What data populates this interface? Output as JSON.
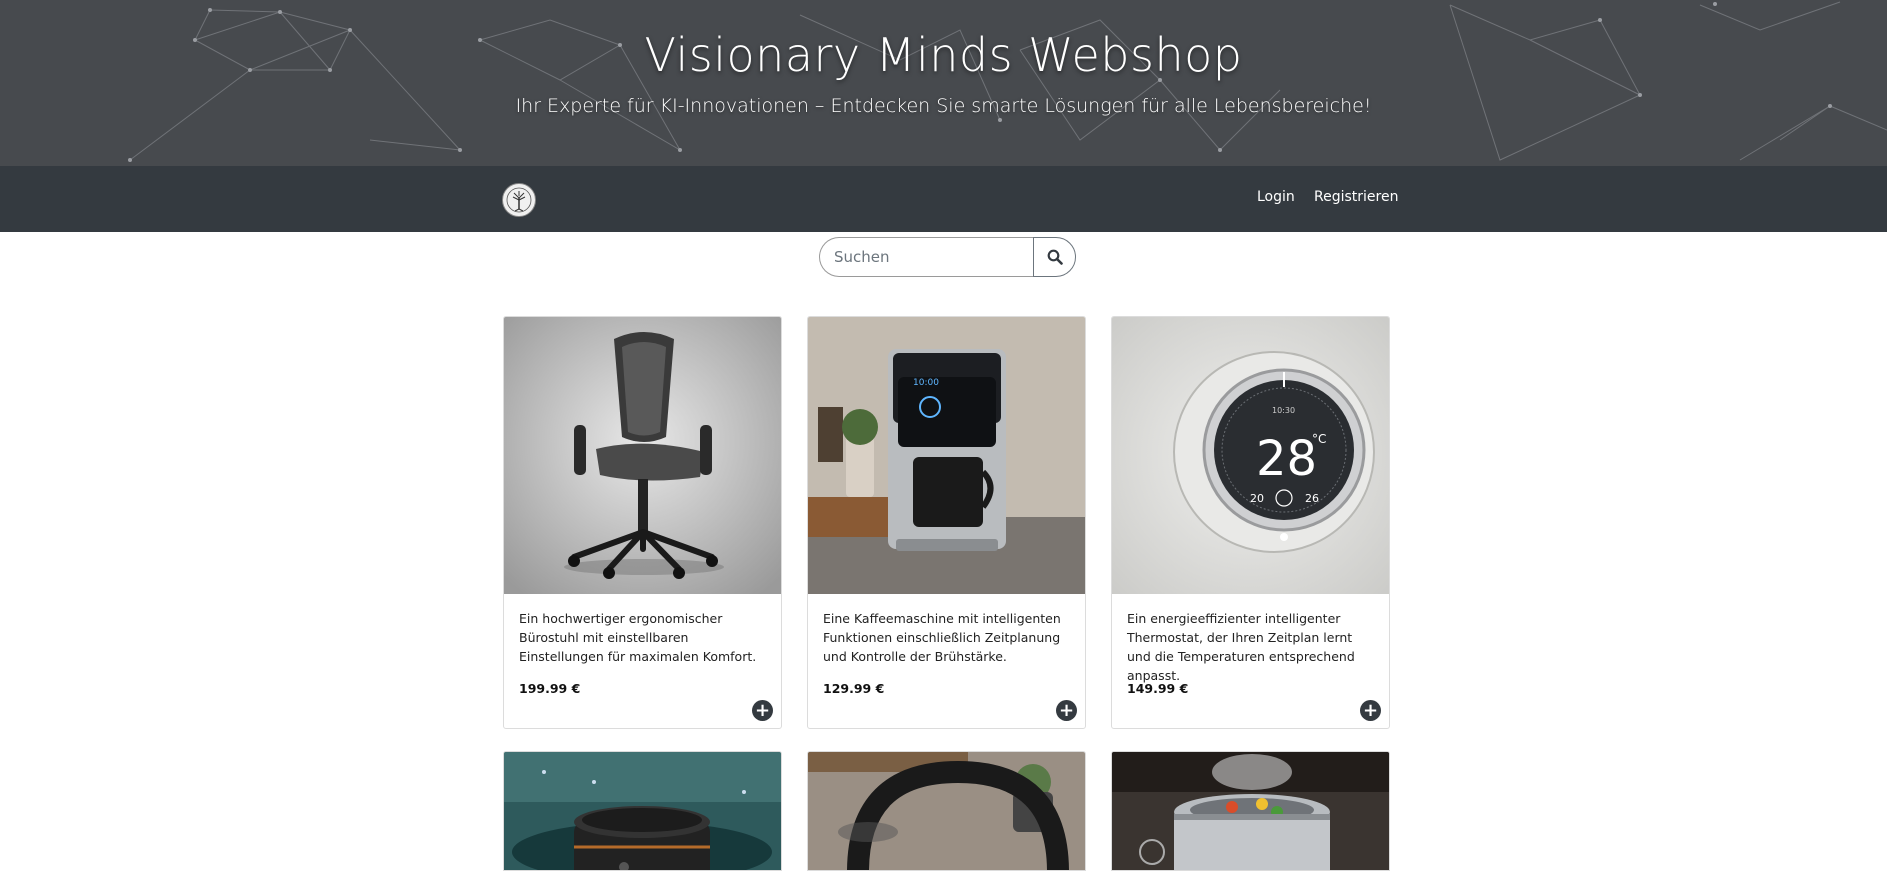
{
  "header": {
    "title": "Visionary Minds Webshop",
    "subtitle": "Ihr Experte für KI-Innovationen – Entdecken Sie smarte Lösungen für alle Lebensbereiche!"
  },
  "nav": {
    "login_label": "Login",
    "register_label": "Registrieren"
  },
  "search": {
    "placeholder": "Suchen"
  },
  "products": [
    {
      "description": "Ein hochwertiger ergonomischer Bürostuhl mit einstellbaren Einstellungen für maximalen Komfort.",
      "price": "199.99 €",
      "image": "office-chair"
    },
    {
      "description": "Eine Kaffeemaschine mit intelligenten Funktionen einschließlich Zeitplanung und Kontrolle der Brühstärke.",
      "price": "129.99 €",
      "image": "coffee-machine"
    },
    {
      "description": "Ein energieeffizienter intelligenter Thermostat, der Ihren Zeitplan lernt und die Temperaturen entsprechend anpasst.",
      "price": "149.99 €",
      "image": "thermostat"
    }
  ],
  "thermostat_display": {
    "temperature": "28",
    "unit": "°C",
    "left": "20",
    "right": "26",
    "time": "10:30"
  },
  "coffee_display": {
    "time": "10:00"
  },
  "partial_products": [
    {
      "image": "speaker"
    },
    {
      "image": "headphones"
    },
    {
      "image": "pressure-cooker"
    }
  ],
  "colors": {
    "hero_bg": "#474a4e",
    "navbar_bg": "#343a40",
    "add_button": "#343a40"
  }
}
